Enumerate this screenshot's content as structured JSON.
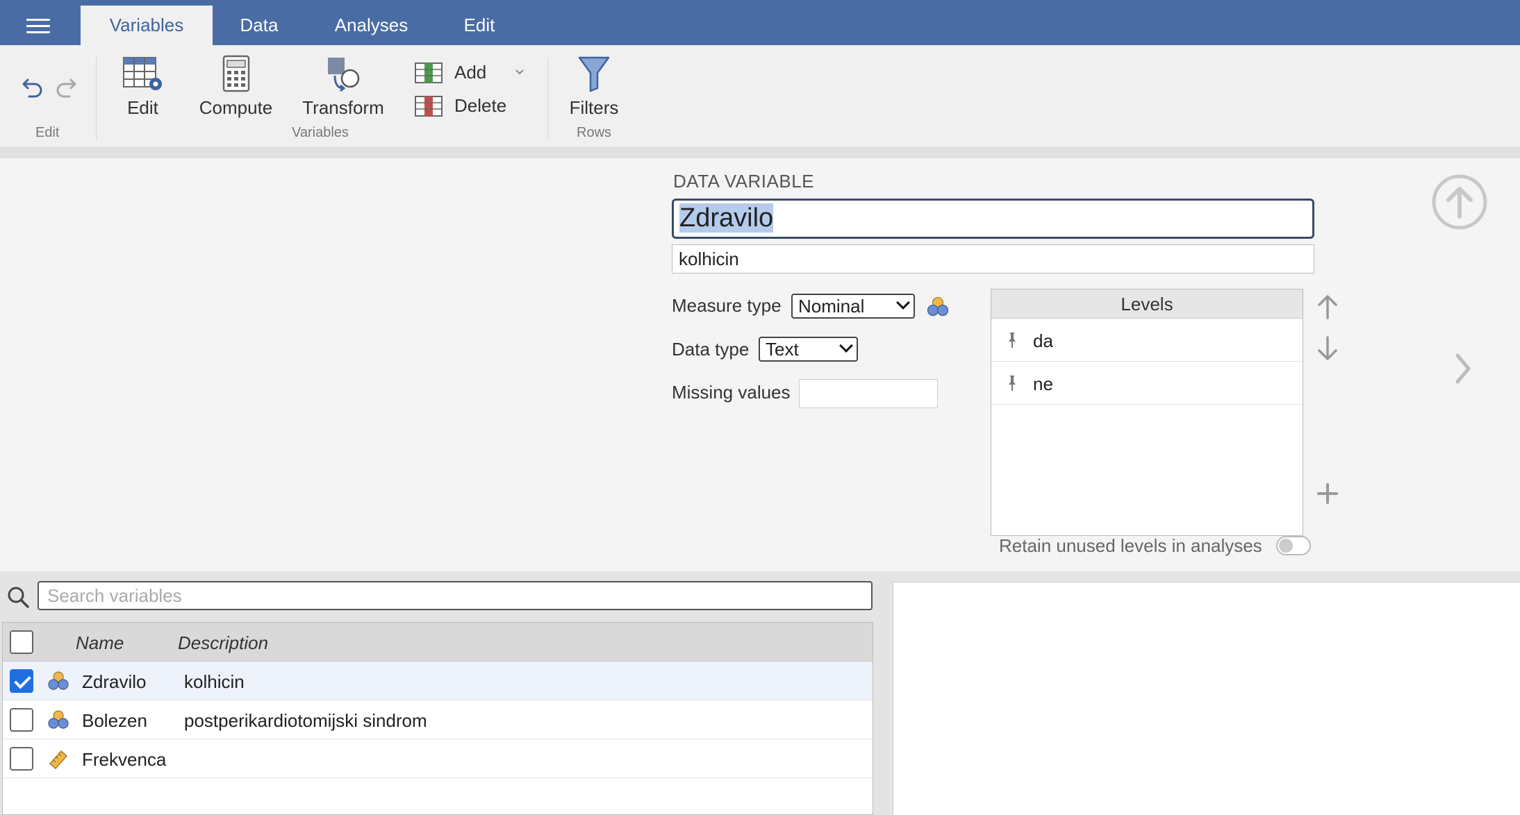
{
  "topbar": {
    "tabs": [
      "Variables",
      "Data",
      "Analyses",
      "Edit"
    ],
    "active_tab": "Variables"
  },
  "ribbon": {
    "buttons": {
      "edit": "Edit",
      "compute": "Compute",
      "transform": "Transform",
      "add": "Add",
      "delete": "Delete",
      "filters": "Filters"
    },
    "groups": {
      "edit": "Edit",
      "variables": "Variables",
      "rows": "Rows"
    }
  },
  "editor": {
    "heading": "DATA VARIABLE",
    "name": "Zdravilo",
    "description": "kolhicin",
    "measure_type_label": "Measure type",
    "measure_type_value": "Nominal",
    "data_type_label": "Data type",
    "data_type_value": "Text",
    "missing_values_label": "Missing values",
    "levels_header": "Levels",
    "levels": [
      "da",
      "ne"
    ],
    "retain_label": "Retain unused levels in analyses"
  },
  "variables_list": {
    "search_placeholder": "Search variables",
    "columns": [
      "Name",
      "Description"
    ],
    "rows": [
      {
        "name": "Zdravilo",
        "description": "kolhicin",
        "checked": true,
        "type": "nominal"
      },
      {
        "name": "Bolezen",
        "description": "postperikardiotomijski sindrom",
        "checked": false,
        "type": "nominal"
      },
      {
        "name": "Frekvenca",
        "description": "",
        "checked": false,
        "type": "continuous"
      }
    ]
  },
  "colors": {
    "topbar": "#4a6ca4",
    "accent": "#3e64a0",
    "checkbox": "#1f6fe0"
  }
}
